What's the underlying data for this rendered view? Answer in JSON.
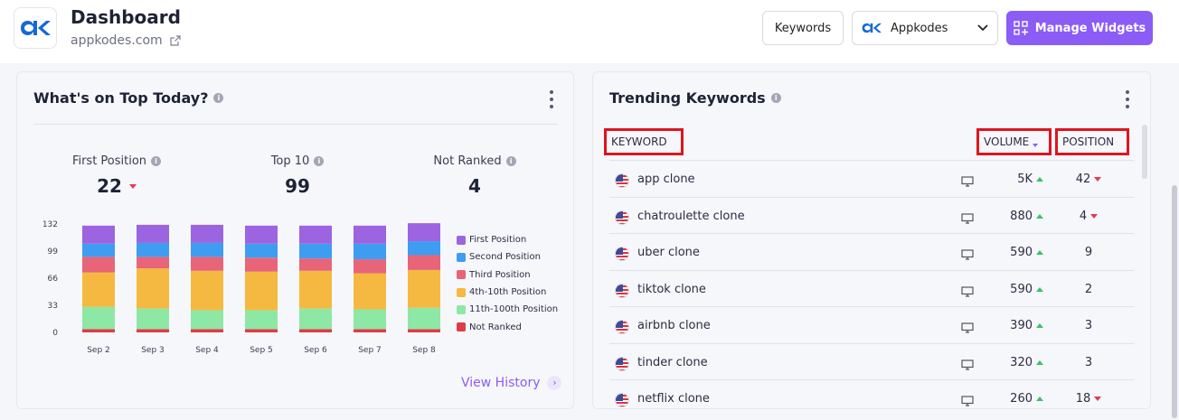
{
  "header": {
    "title": "Dashboard",
    "domain": "appkodes.com",
    "keywords_button": "Keywords",
    "project_select": "Appkodes",
    "manage_widgets": "Manage Widgets"
  },
  "colors": {
    "accent": "#8b5cf6",
    "up": "#3cbf6b",
    "down": "#e53950",
    "highlight_border": "#e0141e"
  },
  "top_today": {
    "title": "What's on Top Today?",
    "stats": [
      {
        "label": "First Position",
        "value": "22",
        "trend": "down"
      },
      {
        "label": "Top 10",
        "value": "99",
        "trend": ""
      },
      {
        "label": "Not Ranked",
        "value": "4",
        "trend": ""
      }
    ],
    "view_history": "View History"
  },
  "chart_data": {
    "type": "bar",
    "stacked": true,
    "categories": [
      "Sep 2",
      "Sep 3",
      "Sep 4",
      "Sep 5",
      "Sep 6",
      "Sep 7",
      "Sep 8"
    ],
    "y_ticks": [
      "0",
      "33",
      "66",
      "99",
      "132"
    ],
    "ylim": [
      0,
      132
    ],
    "series": [
      {
        "name": "Not Ranked",
        "color": "#e03c46",
        "values": [
          4,
          4,
          4,
          4,
          4,
          4,
          4
        ]
      },
      {
        "name": "11th-100th Position",
        "color": "#8ee8a5",
        "values": [
          27,
          25,
          23,
          23,
          25,
          24,
          26
        ]
      },
      {
        "name": "4th-10th Position",
        "color": "#f5b942",
        "values": [
          42,
          49,
          48,
          47,
          46,
          44,
          46
        ]
      },
      {
        "name": "Third Position",
        "color": "#e86478",
        "values": [
          19,
          14,
          17,
          17,
          15,
          17,
          18
        ]
      },
      {
        "name": "Second Position",
        "color": "#3e9df0",
        "values": [
          16,
          17,
          17,
          17,
          18,
          19,
          17
        ]
      },
      {
        "name": "First Position",
        "color": "#9c64e0",
        "values": [
          22,
          22,
          22,
          22,
          22,
          22,
          22
        ]
      }
    ],
    "legend": [
      "First Position",
      "Second Position",
      "Third Position",
      "4th-10th Position",
      "11th-100th Position",
      "Not Ranked"
    ],
    "legend_colors": [
      "#9c64e0",
      "#3e9df0",
      "#e86478",
      "#f5b942",
      "#8ee8a5",
      "#e03c46"
    ],
    "legend_position": "right"
  },
  "trending": {
    "title": "Trending Keywords",
    "columns": {
      "keyword": "KEYWORD",
      "volume": "VOLUME",
      "position": "POSITION"
    },
    "rows": [
      {
        "keyword": "app clone",
        "volume": "5K",
        "position": "42",
        "pos_trend": "down"
      },
      {
        "keyword": "chatroulette clone",
        "volume": "880",
        "position": "4",
        "pos_trend": "down"
      },
      {
        "keyword": "uber clone",
        "volume": "590",
        "position": "9",
        "pos_trend": ""
      },
      {
        "keyword": "tiktok clone",
        "volume": "590",
        "position": "2",
        "pos_trend": ""
      },
      {
        "keyword": "airbnb clone",
        "volume": "390",
        "position": "3",
        "pos_trend": ""
      },
      {
        "keyword": "tinder clone",
        "volume": "320",
        "position": "3",
        "pos_trend": ""
      },
      {
        "keyword": "netflix clone",
        "volume": "260",
        "position": "18",
        "pos_trend": "down"
      }
    ]
  }
}
